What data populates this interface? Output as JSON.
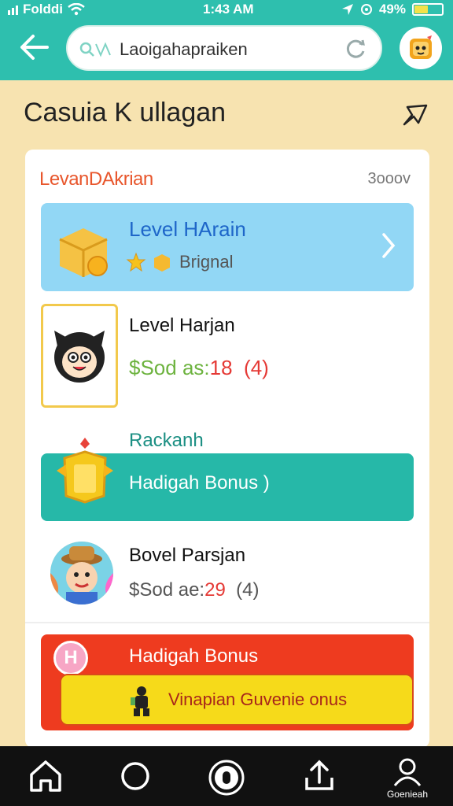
{
  "status_bar": {
    "carrier": "Folddi",
    "time": "1:43 AM",
    "battery": "49%"
  },
  "header": {
    "search_value": "Laoigahapraiken"
  },
  "page": {
    "title": "Casuia K ullagan"
  },
  "card": {
    "heading": "LevanDAkrian",
    "meta": "3ooov",
    "level_row": {
      "title": "Level HArain",
      "subtitle": "Brignal"
    },
    "hargan_row": {
      "name": "Level Harjan",
      "currency": "$Sod",
      "price_label": " as:",
      "amount": "18",
      "badge": "(4)"
    },
    "racks_row": {
      "tab_label": "Rackanh",
      "bar_label": "Hadigah Bonus )"
    },
    "barsjan_row": {
      "name": "Bovel Parsjan",
      "currency": "$Sod",
      "price_label": " ae:",
      "amount": "29",
      "badge": "(4)"
    },
    "bonus_row": {
      "title": "Hadigah Bonus",
      "cta": "Vinapian Guvenie onus"
    }
  },
  "navbar": {
    "profile_label": "Goenieah"
  },
  "colors": {
    "teal": "#2ebfae",
    "background": "#f7e3b0",
    "level_blue": "#92d7f5",
    "bonus_red": "#ee3b1f",
    "cta_yellow": "#f6da1a"
  }
}
